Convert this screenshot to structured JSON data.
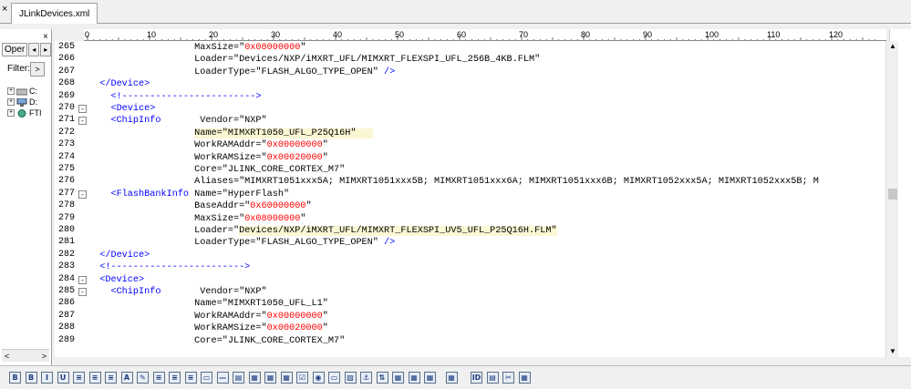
{
  "tab": {
    "title": "JLinkDevices.xml",
    "close": "×"
  },
  "left_panel": {
    "close": "×",
    "tab_label": "Oper",
    "arrow_left": "◂",
    "arrow_right": "▸",
    "filter_label": "Filter:",
    "filter_btn": ">",
    "tree": [
      {
        "plus": "+",
        "label": "C:"
      },
      {
        "plus": "+",
        "label": "D:"
      },
      {
        "plus": "+",
        "label": "FTI"
      }
    ],
    "scroll_left": "<",
    "scroll_right": ">"
  },
  "ruler": {
    "labels": [
      "0",
      "10",
      "20",
      "30",
      "40",
      "50",
      "60",
      "70",
      "80",
      "90",
      "100",
      "110",
      "120"
    ]
  },
  "colors": {
    "tag": "#0000ff",
    "hex": "#ff0000",
    "highlight": "#fbf7d4"
  },
  "lines": [
    {
      "n": "265",
      "fold": "",
      "segs": [
        {
          "c": "attr",
          "t": "                   MaxSize=\""
        },
        {
          "c": "hex",
          "t": "0x08000000"
        },
        {
          "c": "attr",
          "t": "\""
        }
      ]
    },
    {
      "n": "266",
      "fold": "",
      "segs": [
        {
          "c": "attr",
          "t": "                   Loader=\"Devices/NXP/iMXRT_UFL/MIMXRT_FLEXSPI_UFL_256B_4KB.FLM\""
        }
      ]
    },
    {
      "n": "267",
      "fold": "",
      "segs": [
        {
          "c": "attr",
          "t": "                   LoaderType=\"FLASH_ALGO_TYPE_OPEN\" "
        },
        {
          "c": "tag",
          "t": "/>"
        }
      ]
    },
    {
      "n": "268",
      "fold": "",
      "segs": [
        {
          "c": "tag",
          "t": "  </Device>"
        }
      ]
    },
    {
      "n": "269",
      "fold": "",
      "segs": [
        {
          "c": "comment",
          "t": "    <!------------------------>"
        }
      ]
    },
    {
      "n": "270",
      "fold": "-",
      "segs": [
        {
          "c": "tag",
          "t": "    <Device>"
        }
      ]
    },
    {
      "n": "271",
      "fold": "-",
      "segs": [
        {
          "c": "tag",
          "t": "    <ChipInfo"
        },
        {
          "c": "attr",
          "t": "       Vendor=\"NXP\""
        }
      ]
    },
    {
      "n": "272",
      "fold": "",
      "segs": [
        {
          "c": "attr",
          "t": "                   "
        },
        {
          "c": "attr hl",
          "t": "Name=\"MIMXRT1050_UFL_P25Q16H\"   "
        }
      ]
    },
    {
      "n": "273",
      "fold": "",
      "segs": [
        {
          "c": "attr",
          "t": "                   WorkRAMAddr=\""
        },
        {
          "c": "hex",
          "t": "0x00000000"
        },
        {
          "c": "attr",
          "t": "\""
        }
      ]
    },
    {
      "n": "274",
      "fold": "",
      "segs": [
        {
          "c": "attr",
          "t": "                   WorkRAMSize=\""
        },
        {
          "c": "hex",
          "t": "0x00020000"
        },
        {
          "c": "attr",
          "t": "\""
        }
      ]
    },
    {
      "n": "275",
      "fold": "",
      "segs": [
        {
          "c": "attr",
          "t": "                   Core=\"JLINK_CORE_CORTEX_M7\""
        }
      ]
    },
    {
      "n": "276",
      "fold": "",
      "segs": [
        {
          "c": "attr",
          "t": "                   Aliases=\"MIMXRT1051xxx5A; MIMXRT1051xxx5B; MIMXRT1051xxx6A; MIMXRT1051xxx6B; MIMXRT1052xxx5A; MIMXRT1052xxx5B; M"
        }
      ]
    },
    {
      "n": "277",
      "fold": "-",
      "segs": [
        {
          "c": "tag",
          "t": "    <FlashBankInfo"
        },
        {
          "c": "attr",
          "t": " Name=\"HyperFlash\""
        }
      ]
    },
    {
      "n": "278",
      "fold": "",
      "segs": [
        {
          "c": "attr",
          "t": "                   BaseAddr=\""
        },
        {
          "c": "hex",
          "t": "0x60000000"
        },
        {
          "c": "attr",
          "t": "\""
        }
      ]
    },
    {
      "n": "279",
      "fold": "",
      "segs": [
        {
          "c": "attr",
          "t": "                   MaxSize=\""
        },
        {
          "c": "hex",
          "t": "0x08000000"
        },
        {
          "c": "attr",
          "t": "\""
        }
      ]
    },
    {
      "n": "280",
      "fold": "",
      "segs": [
        {
          "c": "attr",
          "t": "                   Loader=\""
        },
        {
          "c": "attr hl",
          "t": "Devices/NXP/iMXRT_UFL/MIMXRT_FLEXSPI_UV5_UFL_P25Q16H.FLM\""
        }
      ]
    },
    {
      "n": "281",
      "fold": "",
      "segs": [
        {
          "c": "attr",
          "t": "                   LoaderType=\"FLASH_ALGO_TYPE_OPEN\" "
        },
        {
          "c": "tag",
          "t": "/>"
        }
      ]
    },
    {
      "n": "282",
      "fold": "",
      "segs": [
        {
          "c": "tag",
          "t": "  </Device>"
        }
      ]
    },
    {
      "n": "283",
      "fold": "",
      "segs": [
        {
          "c": "comment",
          "t": "  <!------------------------>"
        }
      ]
    },
    {
      "n": "284",
      "fold": "-",
      "segs": [
        {
          "c": "tag",
          "t": "  <Device>"
        }
      ]
    },
    {
      "n": "285",
      "fold": "-",
      "segs": [
        {
          "c": "tag",
          "t": "    <ChipInfo"
        },
        {
          "c": "attr",
          "t": "       Vendor=\"NXP\""
        }
      ]
    },
    {
      "n": "286",
      "fold": "",
      "segs": [
        {
          "c": "attr",
          "t": "                   Name=\"MIMXRT1050_UFL_L1\""
        }
      ]
    },
    {
      "n": "287",
      "fold": "",
      "segs": [
        {
          "c": "attr",
          "t": "                   WorkRAMAddr=\""
        },
        {
          "c": "hex",
          "t": "0x00000000"
        },
        {
          "c": "attr",
          "t": "\""
        }
      ]
    },
    {
      "n": "288",
      "fold": "",
      "segs": [
        {
          "c": "attr",
          "t": "                   WorkRAMSize=\""
        },
        {
          "c": "hex",
          "t": "0x00020000"
        },
        {
          "c": "attr",
          "t": "\""
        }
      ]
    },
    {
      "n": "289",
      "fold": "",
      "segs": [
        {
          "c": "attr",
          "t": "                   Core=\"JLINK_CORE_CORTEX_M7\""
        }
      ]
    }
  ],
  "toolbar": {
    "icons": [
      "B",
      "B",
      "I",
      "U",
      "≡",
      "≡",
      "≡",
      "A",
      "✎",
      "≡",
      "≡",
      "≡",
      "▭",
      "—",
      "▤",
      "▦",
      "▦",
      "▦",
      "☑",
      "◉",
      "▭",
      "▨",
      "⚓",
      "⇅",
      "▦",
      "▦",
      "▦",
      "▦",
      "ID",
      "▤",
      "✂",
      "▦"
    ],
    "names": [
      "bold-icon",
      "bold-alt-icon",
      "italic-icon",
      "underline-icon",
      "indent-icon",
      "bullet-list-icon",
      "numbered-list-icon",
      "font-icon",
      "edit-icon",
      "align-left-icon",
      "align-center-icon",
      "align-right-icon",
      "frame-icon",
      "hr-icon",
      "table-icon",
      "grid-icon",
      "form-icon",
      "field-icon",
      "checkbox-icon",
      "radio-icon",
      "textbox-icon",
      "image-icon",
      "anchor-icon",
      "sort-icon",
      "matrix-icon",
      "list-icon",
      "db-icon",
      "db2-icon",
      "id-icon",
      "code-icon",
      "cut-icon",
      "export-icon"
    ]
  }
}
